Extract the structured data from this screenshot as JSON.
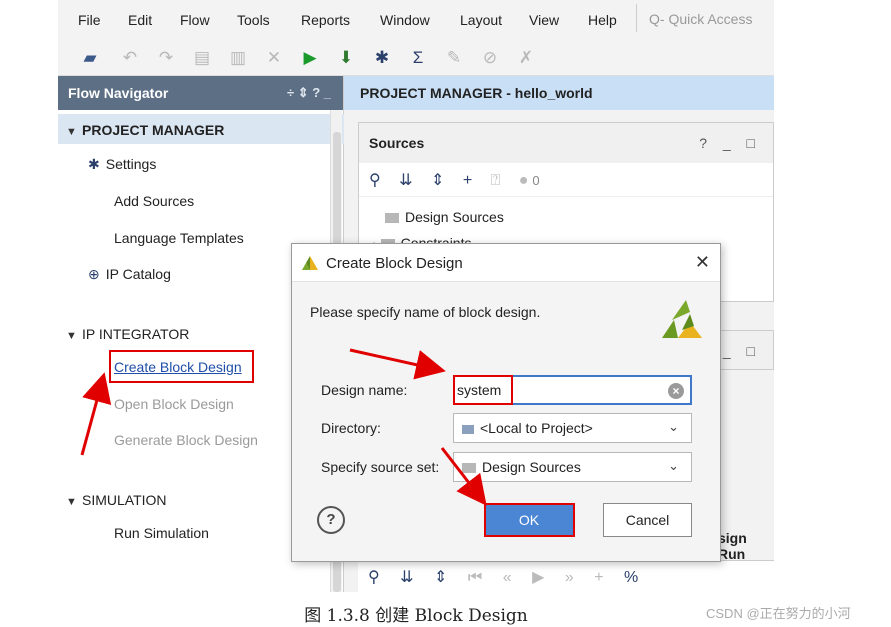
{
  "menubar": {
    "items": [
      "File",
      "Edit",
      "Flow",
      "Tools",
      "Reports",
      "Window",
      "Layout",
      "View",
      "Help"
    ],
    "quick_access_placeholder": "Q- Quick Access"
  },
  "flow_navigator": {
    "title": "Flow Navigator",
    "header_icons": "÷ ⇕ ?  _",
    "project_manager": {
      "label": "PROJECT MANAGER",
      "items": [
        "Settings",
        "Add Sources",
        "Language Templates",
        "IP Catalog"
      ]
    },
    "ip_integrator": {
      "label": "IP INTEGRATOR",
      "items": [
        "Create Block Design",
        "Open Block Design",
        "Generate Block Design"
      ]
    },
    "simulation": {
      "label": "SIMULATION",
      "items": [
        "Run Simulation"
      ]
    }
  },
  "main": {
    "pm_bar": "PROJECT MANAGER - hello_world",
    "sources": {
      "title": "Sources",
      "controls": "? _ □",
      "count": "0",
      "rows": [
        "Design Sources",
        "Constraints"
      ]
    },
    "panel_controls": "_ □",
    "design_runs_partial": "sign Run"
  },
  "dialog": {
    "title": "Create Block Design",
    "prompt": "Please specify name of block design.",
    "design_name_label": "Design name:",
    "design_name_value": "system",
    "directory_label": "Directory:",
    "directory_value": "<Local to Project>",
    "source_set_label": "Specify source set:",
    "source_set_value": "Design Sources",
    "ok_label": "OK",
    "cancel_label": "Cancel",
    "help_label": "?"
  },
  "caption": "图 1.3.8 创建 Block Design",
  "watermark": "CSDN @正在努力的小河",
  "colors": {
    "nav_header": "#5d6f84",
    "pm_bar": "#c9dff5",
    "ok_button": "#4a86d4",
    "annotation": "#e00000"
  }
}
